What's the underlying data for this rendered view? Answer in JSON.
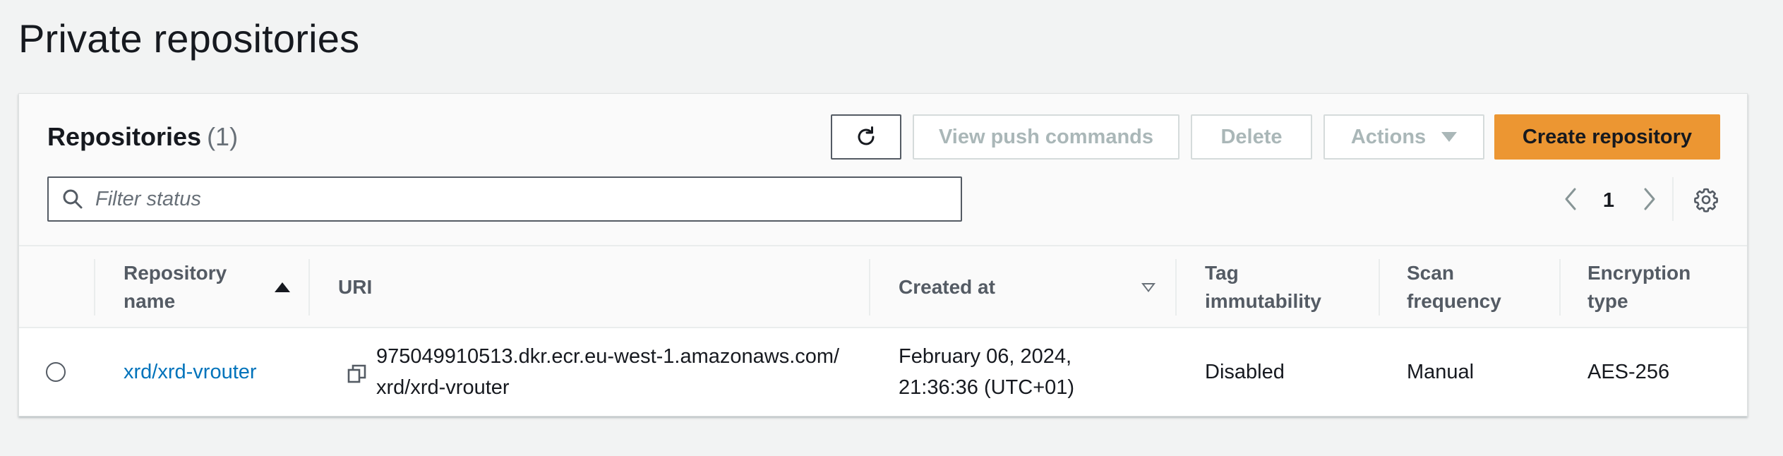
{
  "page": {
    "title": "Private repositories"
  },
  "panel": {
    "heading": "Repositories",
    "count": "(1)"
  },
  "toolbar": {
    "refresh_icon": "refresh-icon",
    "view_push_label": "View push commands",
    "delete_label": "Delete",
    "actions_label": "Actions",
    "create_label": "Create repository"
  },
  "filter": {
    "placeholder": "Filter status",
    "value": ""
  },
  "pagination": {
    "current_page": "1"
  },
  "table": {
    "columns": [
      {
        "label": "Repository name",
        "line1": "Repository",
        "line2": "name",
        "sort": "ascending"
      },
      {
        "label": "URI",
        "line1": "URI"
      },
      {
        "label": "Created at",
        "line1": "Created at",
        "sort": "sortable"
      },
      {
        "label": "Tag immutability",
        "line1": "Tag",
        "line2": "immutability"
      },
      {
        "label": "Scan frequency",
        "line1": "Scan",
        "line2": "frequency"
      },
      {
        "label": "Encryption type",
        "line1": "Encryption",
        "line2": "type"
      }
    ],
    "rows": [
      {
        "selected": false,
        "repository_name": "xrd/xrd-vrouter",
        "uri_line1": "975049910513.dkr.ecr.eu-west-1.amazonaws.com/",
        "uri_line2": "xrd/xrd-vrouter",
        "created_line1": "February 06, 2024,",
        "created_line2": "21:36:36 (UTC+01)",
        "tag_immutability": "Disabled",
        "scan_frequency": "Manual",
        "encryption_type": "AES-256"
      }
    ]
  },
  "colors": {
    "primary_button": "#ec9632",
    "link": "#0073bb",
    "page_background": "#f2f3f3"
  }
}
